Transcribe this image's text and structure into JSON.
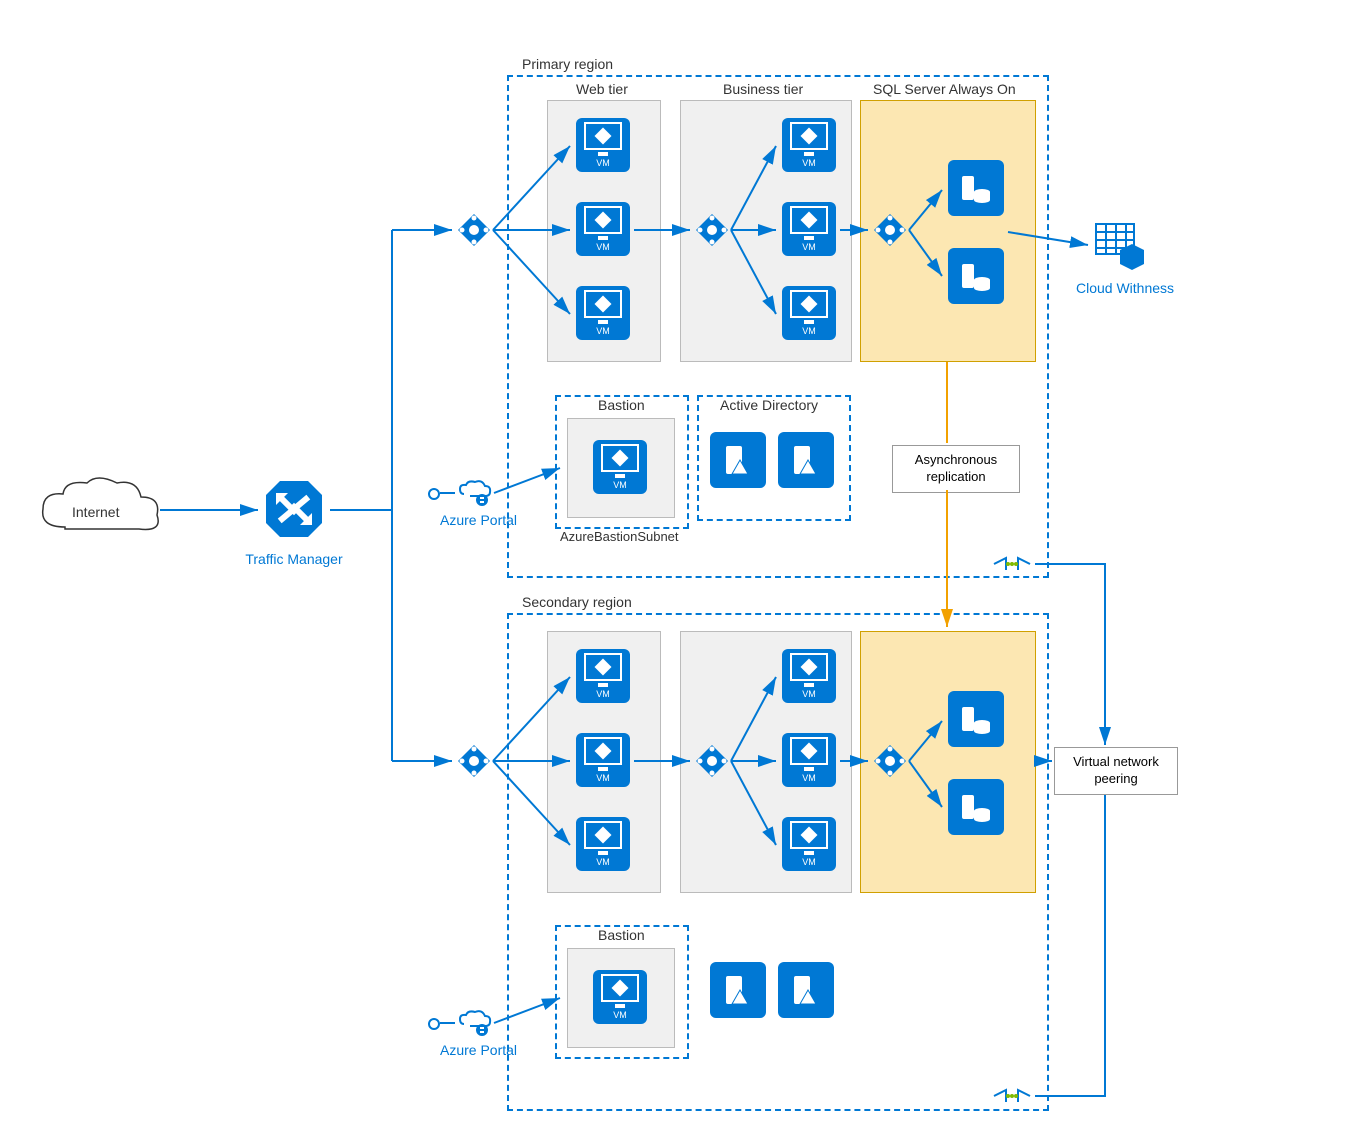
{
  "labels": {
    "internet": "Internet",
    "traffic_manager": "Traffic Manager",
    "azure_portal": "Azure Portal",
    "cloud_witness": "Cloud Withness",
    "virtual_network_peering": "Virtual network\npeering",
    "async_replication": "Asynchronous\nreplication"
  },
  "regions": {
    "primary": {
      "title": "Primary region",
      "web_tier": "Web tier",
      "business_tier": "Business tier",
      "sql_tier": "SQL Server Always On",
      "bastion": "Bastion",
      "bastion_subnet": "AzureBastionSubnet",
      "active_directory": "Active Directory",
      "vm_label": "VM"
    },
    "secondary": {
      "title": "Secondary region",
      "bastion": "Bastion",
      "vm_label": "VM"
    }
  }
}
